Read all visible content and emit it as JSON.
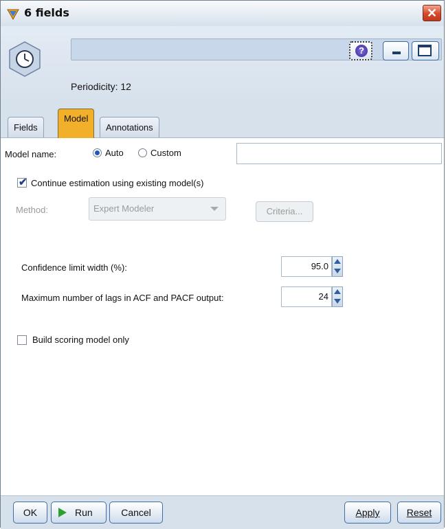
{
  "window": {
    "title": "6 fields",
    "close_glyph": "✕"
  },
  "header": {
    "periodicity": "Periodicity: 12",
    "help_glyph": "?"
  },
  "tabs": [
    {
      "label": "Fields",
      "active": false
    },
    {
      "label": "Model",
      "active": true
    },
    {
      "label": "Annotations",
      "active": false
    }
  ],
  "model": {
    "name_label": "Model name:",
    "auto_label": "Auto",
    "custom_label": "Custom",
    "name_mode": "Auto",
    "custom_name_value": "",
    "continue_label": "Continue estimation using existing model(s)",
    "continue_checked": true,
    "method_label": "Method:",
    "method_value": "Expert Modeler",
    "criteria_label": "Criteria...",
    "confidence_label": "Confidence limit width (%):",
    "confidence_value": "95.0",
    "lags_label": "Maximum number of lags in ACF and PACF output:",
    "lags_value": "24",
    "build_scoring_label": "Build scoring model only",
    "build_scoring_checked": false
  },
  "footer": {
    "ok": "OK",
    "run": "Run",
    "cancel": "Cancel",
    "apply": "Apply",
    "reset": "Reset"
  },
  "colors": {
    "active_tab": "#f2b02a",
    "close_button": "#d4492a",
    "chrome": "#d7e1ec"
  }
}
